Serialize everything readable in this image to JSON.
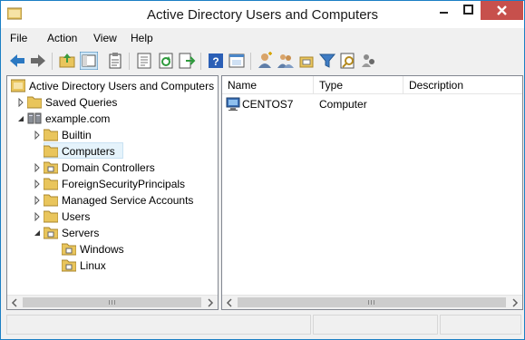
{
  "window": {
    "title": "Active Directory Users and Computers"
  },
  "menubar": {
    "items": [
      "File",
      "Action",
      "View",
      "Help"
    ]
  },
  "toolbar": {
    "buttons": [
      "back-icon",
      "forward-icon",
      "up-folder-icon",
      "show-hide-tree-icon",
      "clipboard-icon",
      "properties-icon",
      "refresh-icon",
      "export-list-icon",
      "help-icon",
      "console-tree-icon",
      "new-user-icon",
      "new-group-icon",
      "new-ou-icon",
      "filter-icon",
      "find-icon",
      "add-to-group-icon"
    ]
  },
  "tree": {
    "root": "Active Directory Users and Computers",
    "saved_queries": "Saved Queries",
    "domain": "example.com",
    "builtin": "Builtin",
    "computers": "Computers",
    "domain_controllers": "Domain Controllers",
    "foreign_security_principals": "ForeignSecurityPrincipals",
    "managed_service_accounts": "Managed Service Accounts",
    "users": "Users",
    "servers": "Servers",
    "windows": "Windows",
    "linux": "Linux"
  },
  "list": {
    "columns": {
      "name": "Name",
      "type": "Type",
      "description": "Description"
    },
    "rows": [
      {
        "name": "CENTOS7",
        "type": "Computer",
        "description": ""
      }
    ]
  },
  "colors": {
    "accent": "#1b7fc4",
    "close": "#c7504c",
    "selection": "#e5f3fb",
    "folder": "#e9c55c"
  }
}
